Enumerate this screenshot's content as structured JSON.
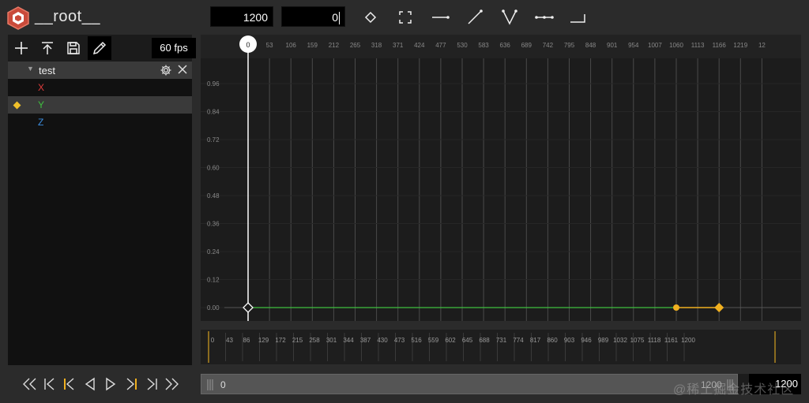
{
  "app": {
    "title": "__root__"
  },
  "header": {
    "total_frames": "1200",
    "current_frame": "0",
    "tools": [
      {
        "name": "keyframe-diamond-icon"
      },
      {
        "name": "fit-view-icon"
      },
      {
        "name": "constant-interp-icon"
      },
      {
        "name": "linear-interp-icon"
      },
      {
        "name": "break-tangent-icon"
      },
      {
        "name": "flat-tangent-icon"
      },
      {
        "name": "step-interp-icon"
      }
    ]
  },
  "left_toolbar": {
    "buttons": [
      {
        "name": "add-icon"
      },
      {
        "name": "export-icon"
      },
      {
        "name": "save-icon"
      },
      {
        "name": "edit-icon"
      }
    ],
    "fps": "60 fps"
  },
  "outline": {
    "object_name": "test",
    "tracks": [
      {
        "label": "X",
        "color": "#e03c3c",
        "selected": false,
        "has_key": false
      },
      {
        "label": "Y",
        "color": "#3ec03e",
        "selected": true,
        "has_key": true
      },
      {
        "label": "Z",
        "color": "#3c8ee0",
        "selected": false,
        "has_key": false
      }
    ]
  },
  "graph": {
    "playhead_frame": "0",
    "frame_ticks": [
      "53",
      "106",
      "159",
      "212",
      "265",
      "318",
      "371",
      "424",
      "477",
      "530",
      "583",
      "636",
      "689",
      "742",
      "795",
      "848",
      "901",
      "954",
      "1007",
      "1060",
      "1113",
      "1166",
      "1219",
      "12"
    ],
    "value_ticks": [
      "0.96",
      "0.84",
      "0.72",
      "0.60",
      "0.48",
      "0.36",
      "0.24",
      "0.12",
      "0.00"
    ],
    "curve_color": "#3ec03e",
    "selected_color": "#f0b020"
  },
  "overview": {
    "ticks": [
      "0",
      "43",
      "86",
      "129",
      "172",
      "215",
      "258",
      "301",
      "344",
      "387",
      "430",
      "473",
      "516",
      "559",
      "602",
      "645",
      "688",
      "731",
      "774",
      "817",
      "860",
      "903",
      "946",
      "989",
      "1032",
      "1075",
      "1118",
      "1161",
      "1200"
    ]
  },
  "playback": {
    "buttons": [
      {
        "name": "rewind-icon"
      },
      {
        "name": "first-frame-icon"
      },
      {
        "name": "prev-keyframe-icon"
      },
      {
        "name": "play-backward-icon"
      },
      {
        "name": "play-forward-icon"
      },
      {
        "name": "next-keyframe-icon"
      },
      {
        "name": "last-frame-icon"
      },
      {
        "name": "fast-forward-icon"
      }
    ]
  },
  "scrollbar": {
    "start": "0",
    "end": "1200",
    "end_value": "1200"
  },
  "watermark": "@稀土掘金技术社区"
}
